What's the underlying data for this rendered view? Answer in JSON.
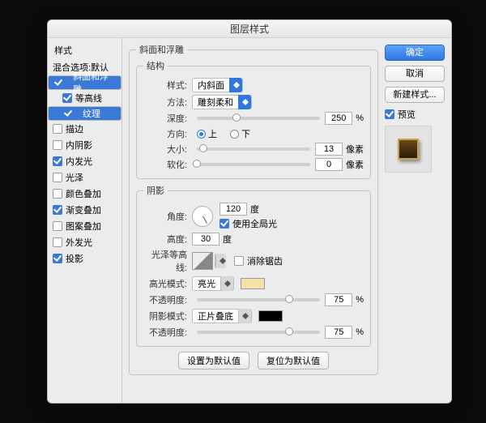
{
  "title": "图层样式",
  "styles": {
    "header": "样式",
    "blending": "混合选项:默认",
    "items": [
      {
        "label": "斜面和浮雕",
        "on": true,
        "sel": true
      },
      {
        "label": "等高线",
        "on": true,
        "sub": true
      },
      {
        "label": "纹理",
        "on": true,
        "sub": true,
        "sel": true
      },
      {
        "label": "描边",
        "on": false
      },
      {
        "label": "内阴影",
        "on": false
      },
      {
        "label": "内发光",
        "on": true
      },
      {
        "label": "光泽",
        "on": false
      },
      {
        "label": "颜色叠加",
        "on": false
      },
      {
        "label": "渐变叠加",
        "on": true
      },
      {
        "label": "图案叠加",
        "on": false
      },
      {
        "label": "外发光",
        "on": false
      },
      {
        "label": "投影",
        "on": true
      }
    ]
  },
  "bevel": {
    "group": "斜面和浮雕",
    "structure": "结构",
    "styleLabel": "样式:",
    "styleValue": "内斜面",
    "techLabel": "方法:",
    "techValue": "雕刻柔和",
    "depthLabel": "深度:",
    "depthValue": "250",
    "pct": "%",
    "dirLabel": "方向:",
    "up": "上",
    "down": "下",
    "sizeLabel": "大小:",
    "sizeValue": "13",
    "px": "像素",
    "softLabel": "软化:",
    "softValue": "0"
  },
  "shade": {
    "group": "阴影",
    "angleLabel": "角度:",
    "angleValue": "120",
    "deg": "度",
    "globalLight": "使用全局光",
    "altLabel": "高度:",
    "altValue": "30",
    "contourLabel": "光泽等高线:",
    "antiAlias": "消除锯齿",
    "hiLabel": "高光模式:",
    "hiValue": "亮光",
    "opLabel": "不透明度:",
    "hiOp": "75",
    "shLabel": "阴影模式:",
    "shValue": "正片叠底",
    "shOp": "75"
  },
  "footer": {
    "a": "设置为默认值",
    "b": "复位为默认值"
  },
  "right": {
    "ok": "确定",
    "cancel": "取消",
    "new": "新建样式...",
    "preview": "预览"
  },
  "colors": {
    "hiSwatch": "#f2e2a8",
    "shSwatch": "#000000"
  }
}
